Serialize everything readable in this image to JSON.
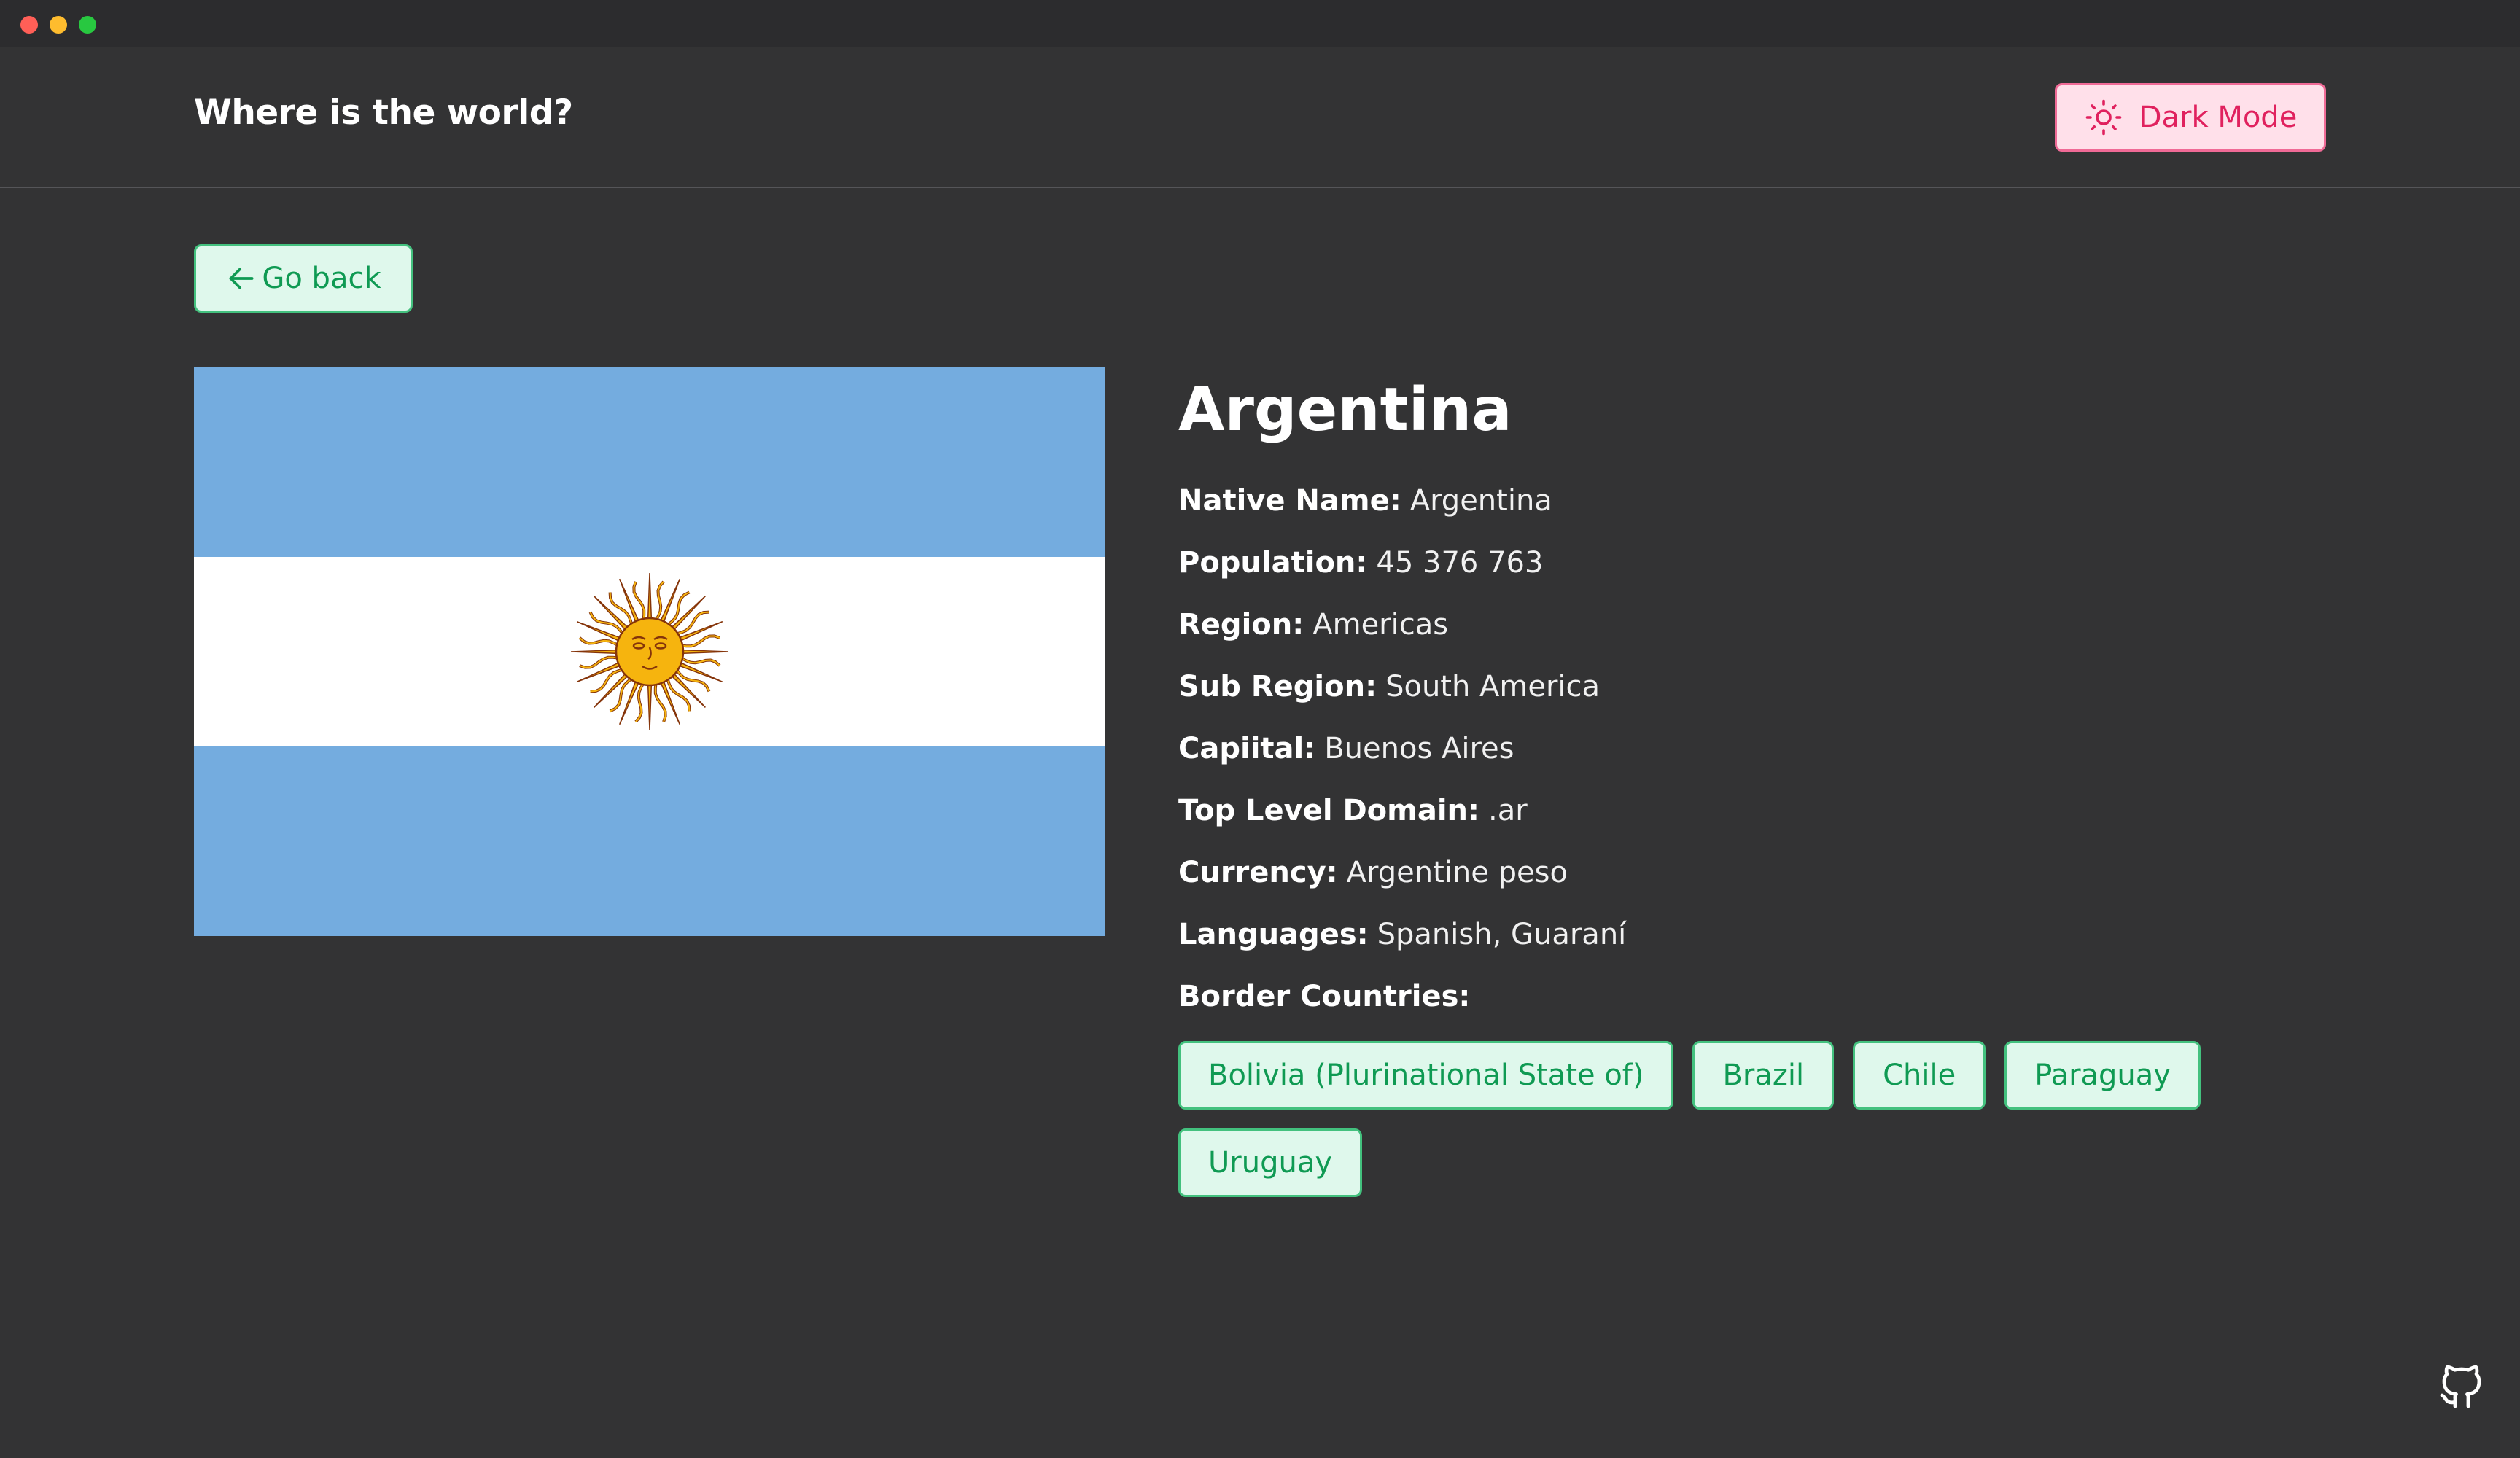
{
  "header": {
    "app_title": "Where is the world?",
    "mode_label": "Dark Mode",
    "mode_icon": "sun-icon"
  },
  "navigation": {
    "back_label": "Go back",
    "back_icon": "arrow-left-icon"
  },
  "country": {
    "name": "Argentina",
    "flag_icon": "argentina-flag",
    "details": [
      {
        "label": "Native Name:",
        "value": "Argentina"
      },
      {
        "label": "Population:",
        "value": "45 376 763"
      },
      {
        "label": "Region:",
        "value": "Americas"
      },
      {
        "label": "Sub Region:",
        "value": "South America"
      },
      {
        "label": "Capiital:",
        "value": "Buenos Aires"
      },
      {
        "label": "Top Level Domain:",
        "value": ".ar"
      },
      {
        "label": "Currency:",
        "value": "Argentine peso"
      },
      {
        "label": "Languages:",
        "value": "Spanish, Guaraní"
      }
    ],
    "border_label": "Border Countries:",
    "borders": [
      "Bolivia (Plurinational State of)",
      "Brazil",
      "Chile",
      "Paraguay",
      "Uruguay"
    ]
  },
  "footer": {
    "github_icon": "github-icon"
  },
  "colors": {
    "background": "#333334",
    "accent_green": "#0f9a53",
    "accent_pink": "#e0215e",
    "flag_blue": "#74acdf",
    "sun_gold": "#f6b40e"
  }
}
